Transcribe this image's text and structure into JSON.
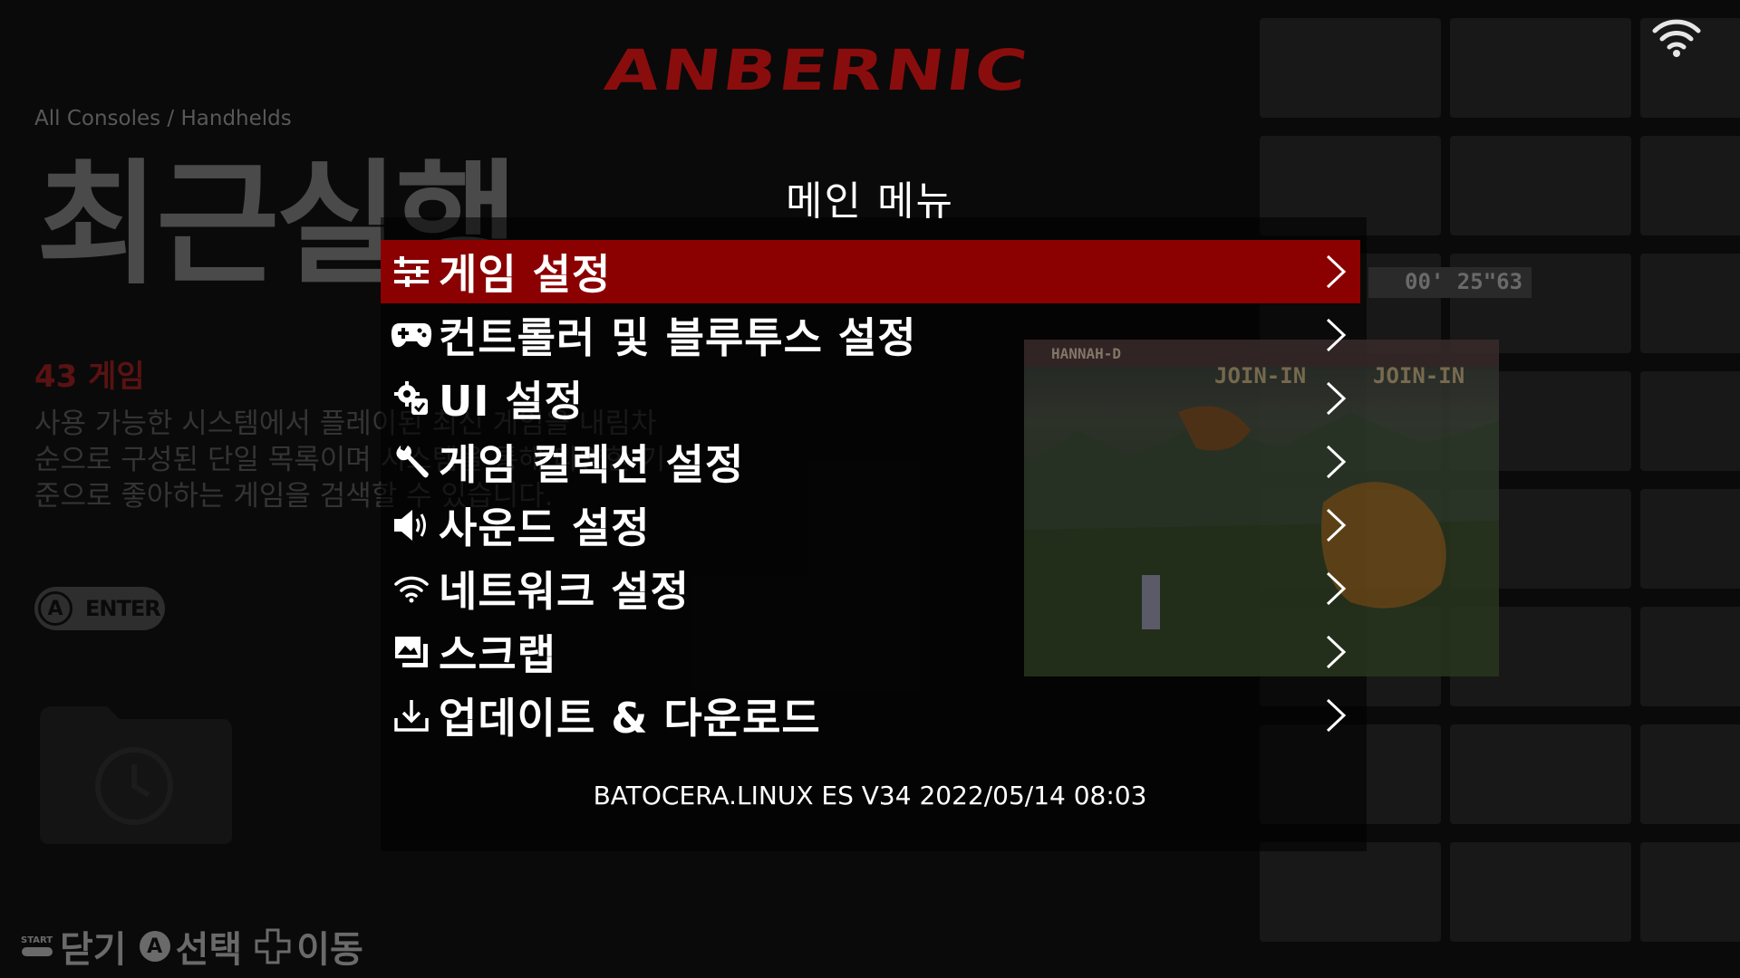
{
  "header": {
    "logo_text": "ANBERNIC",
    "breadcrumb": "All Consoles / Handhelds"
  },
  "background": {
    "title": "최근실행",
    "game_count": "43 게임",
    "description": "사용 가능한 시스템에서 플레이된 최신 게임을 내림차순으로 구성된 단일 목록이며 시스템을 통해 다양한 기준으로 좋아하는 게임을 검색할 수 있습니다.",
    "enter_button": {
      "key": "A",
      "label": "ENTER"
    },
    "screenshot_hud_timer": "00' 25\"63",
    "screenshot_player": "HANNAH-D",
    "screenshot_join_1": "JOIN-IN",
    "screenshot_join_2": "JOIN-IN"
  },
  "menu": {
    "title": "메인 메뉴",
    "items": [
      {
        "label": "게임 설정",
        "icon": "sliders-icon",
        "selected": true
      },
      {
        "label": "컨트롤러 및 블루투스 설정",
        "icon": "gamepad-icon",
        "selected": false
      },
      {
        "label": "UI 설정",
        "icon": "ui-gear-icon",
        "selected": false
      },
      {
        "label": "게임 컬렉션 설정",
        "icon": "wrench-icon",
        "selected": false
      },
      {
        "label": "사운드 설정",
        "icon": "speaker-icon",
        "selected": false
      },
      {
        "label": "네트워크 설정",
        "icon": "wifi-icon",
        "selected": false
      },
      {
        "label": "스크랩",
        "icon": "images-icon",
        "selected": false
      },
      {
        "label": "업데이트 & 다운로드",
        "icon": "download-icon",
        "selected": false
      }
    ],
    "version": "BATOCERA.LINUX ES V34 2022/05/14 08:03"
  },
  "footer": {
    "close": {
      "key": "START",
      "label": "닫기"
    },
    "select": {
      "key": "A",
      "label": "선택"
    },
    "move": {
      "key": "dpad",
      "label": "이동"
    }
  },
  "colors": {
    "selection": "#8b0000",
    "logo": "#8a0d0d"
  }
}
